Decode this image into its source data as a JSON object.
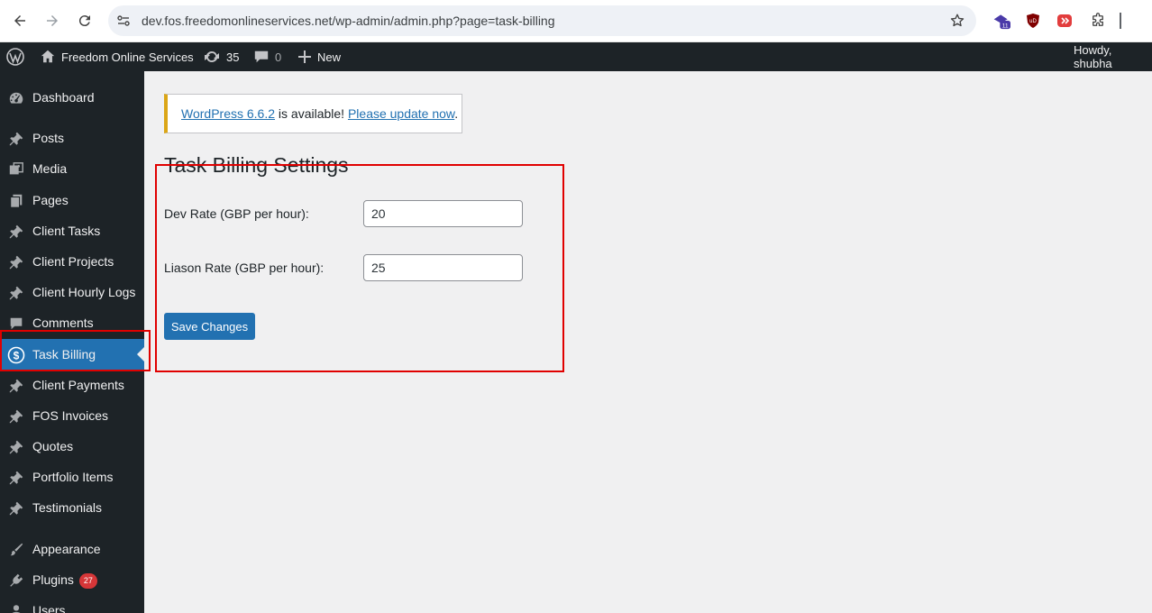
{
  "browser": {
    "url": "dev.fos.freedomonlineservices.net/wp-admin/admin.php?page=task-billing",
    "extensions": [
      {
        "name": "extension-badge-icon",
        "badge": "11"
      },
      {
        "name": "ublock-icon",
        "label": "uD"
      },
      {
        "name": "media-extension-icon"
      },
      {
        "name": "puzzle-icon"
      }
    ]
  },
  "adminbar": {
    "site_name": "Freedom Online Services",
    "updates_count": "35",
    "comments_count": "0",
    "new_label": "New",
    "howdy": "Howdy, shubha"
  },
  "sidebar": {
    "items": [
      {
        "label": "Dashboard",
        "icon": "dashboard-icon"
      },
      {
        "label": "Posts",
        "icon": "pin-icon"
      },
      {
        "label": "Media",
        "icon": "media-icon"
      },
      {
        "label": "Pages",
        "icon": "pages-icon"
      },
      {
        "label": "Client Tasks",
        "icon": "pin-icon"
      },
      {
        "label": "Client Projects",
        "icon": "pin-icon"
      },
      {
        "label": "Client Hourly Logs",
        "icon": "pin-icon"
      },
      {
        "label": "Comments",
        "icon": "comment-icon"
      },
      {
        "label": "Task Billing",
        "icon": "dollar-icon",
        "active": true
      },
      {
        "label": "Client Payments",
        "icon": "pin-icon"
      },
      {
        "label": "FOS Invoices",
        "icon": "pin-icon"
      },
      {
        "label": "Quotes",
        "icon": "pin-icon"
      },
      {
        "label": "Portfolio Items",
        "icon": "pin-icon"
      },
      {
        "label": "Testimonials",
        "icon": "pin-icon"
      },
      {
        "label": "Appearance",
        "icon": "brush-icon"
      },
      {
        "label": "Plugins",
        "icon": "plugin-icon",
        "badge": "27"
      },
      {
        "label": "Users",
        "icon": "users-icon"
      }
    ]
  },
  "notice": {
    "link1": "WordPress 6.6.2",
    "middle": " is available! ",
    "link2": "Please update now",
    "end": "."
  },
  "page": {
    "title": "Task Billing Settings",
    "dev_rate_label": "Dev Rate (GBP per hour):",
    "dev_rate_value": "20",
    "liason_rate_label": "Liason Rate (GBP per hour):",
    "liason_rate_value": "25",
    "save_label": "Save Changes"
  },
  "colors": {
    "admin_dark": "#1d2327",
    "accent": "#2271b1",
    "notice_warning": "#dba617",
    "highlight_red": "#e00000",
    "badge_red": "#d63638"
  }
}
